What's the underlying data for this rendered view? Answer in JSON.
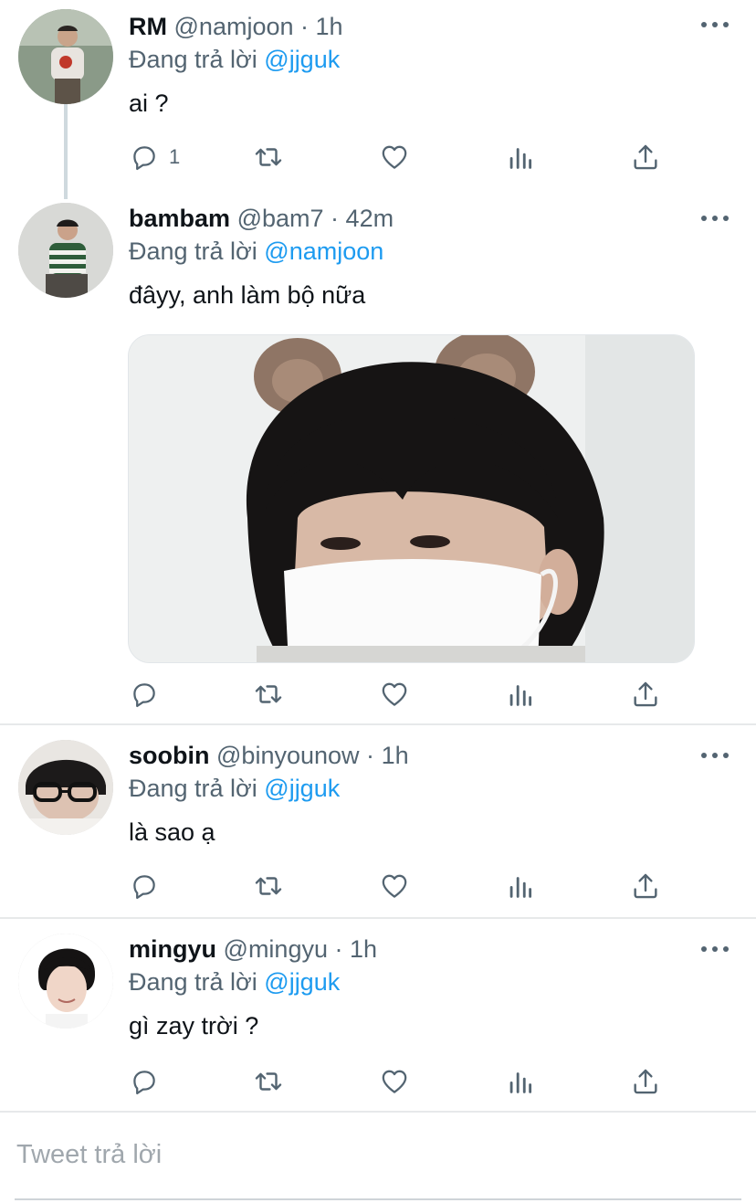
{
  "tweets": [
    {
      "name": "RM",
      "handle": "@namjoon",
      "dot": "·",
      "time": "1h",
      "reply_prefix": "Đang trả lời",
      "reply_to": "@jjguk",
      "text": "ai ?",
      "reply_count": "1"
    },
    {
      "name": "bambam",
      "handle": "@bam7",
      "dot": "·",
      "time": "42m",
      "reply_prefix": "Đang trả lời",
      "reply_to": "@namjoon",
      "text": "đâyy, anh làm bộ nữa",
      "reply_count": ""
    },
    {
      "name": "soobin",
      "handle": "@binyounow",
      "dot": "·",
      "time": "1h",
      "reply_prefix": "Đang trả lời",
      "reply_to": "@jjguk",
      "text": "là sao ạ",
      "reply_count": ""
    },
    {
      "name": "mingyu",
      "handle": "@mingyu",
      "dot": "·",
      "time": "1h",
      "reply_prefix": "Đang trả lời",
      "reply_to": "@jjguk",
      "text": "gì zay trời ?",
      "reply_count": ""
    }
  ],
  "compose": {
    "placeholder": "Tweet trả lời"
  },
  "icons": {
    "reply": "reply-icon",
    "retweet": "retweet-icon",
    "like": "heart-icon",
    "analytics": "analytics-icon",
    "share": "share-icon",
    "more": "more-icon"
  },
  "colors": {
    "accent": "#1d9bf0",
    "secondary_text": "#536471",
    "icon": "#536471",
    "divider": "#e7e9ea"
  }
}
